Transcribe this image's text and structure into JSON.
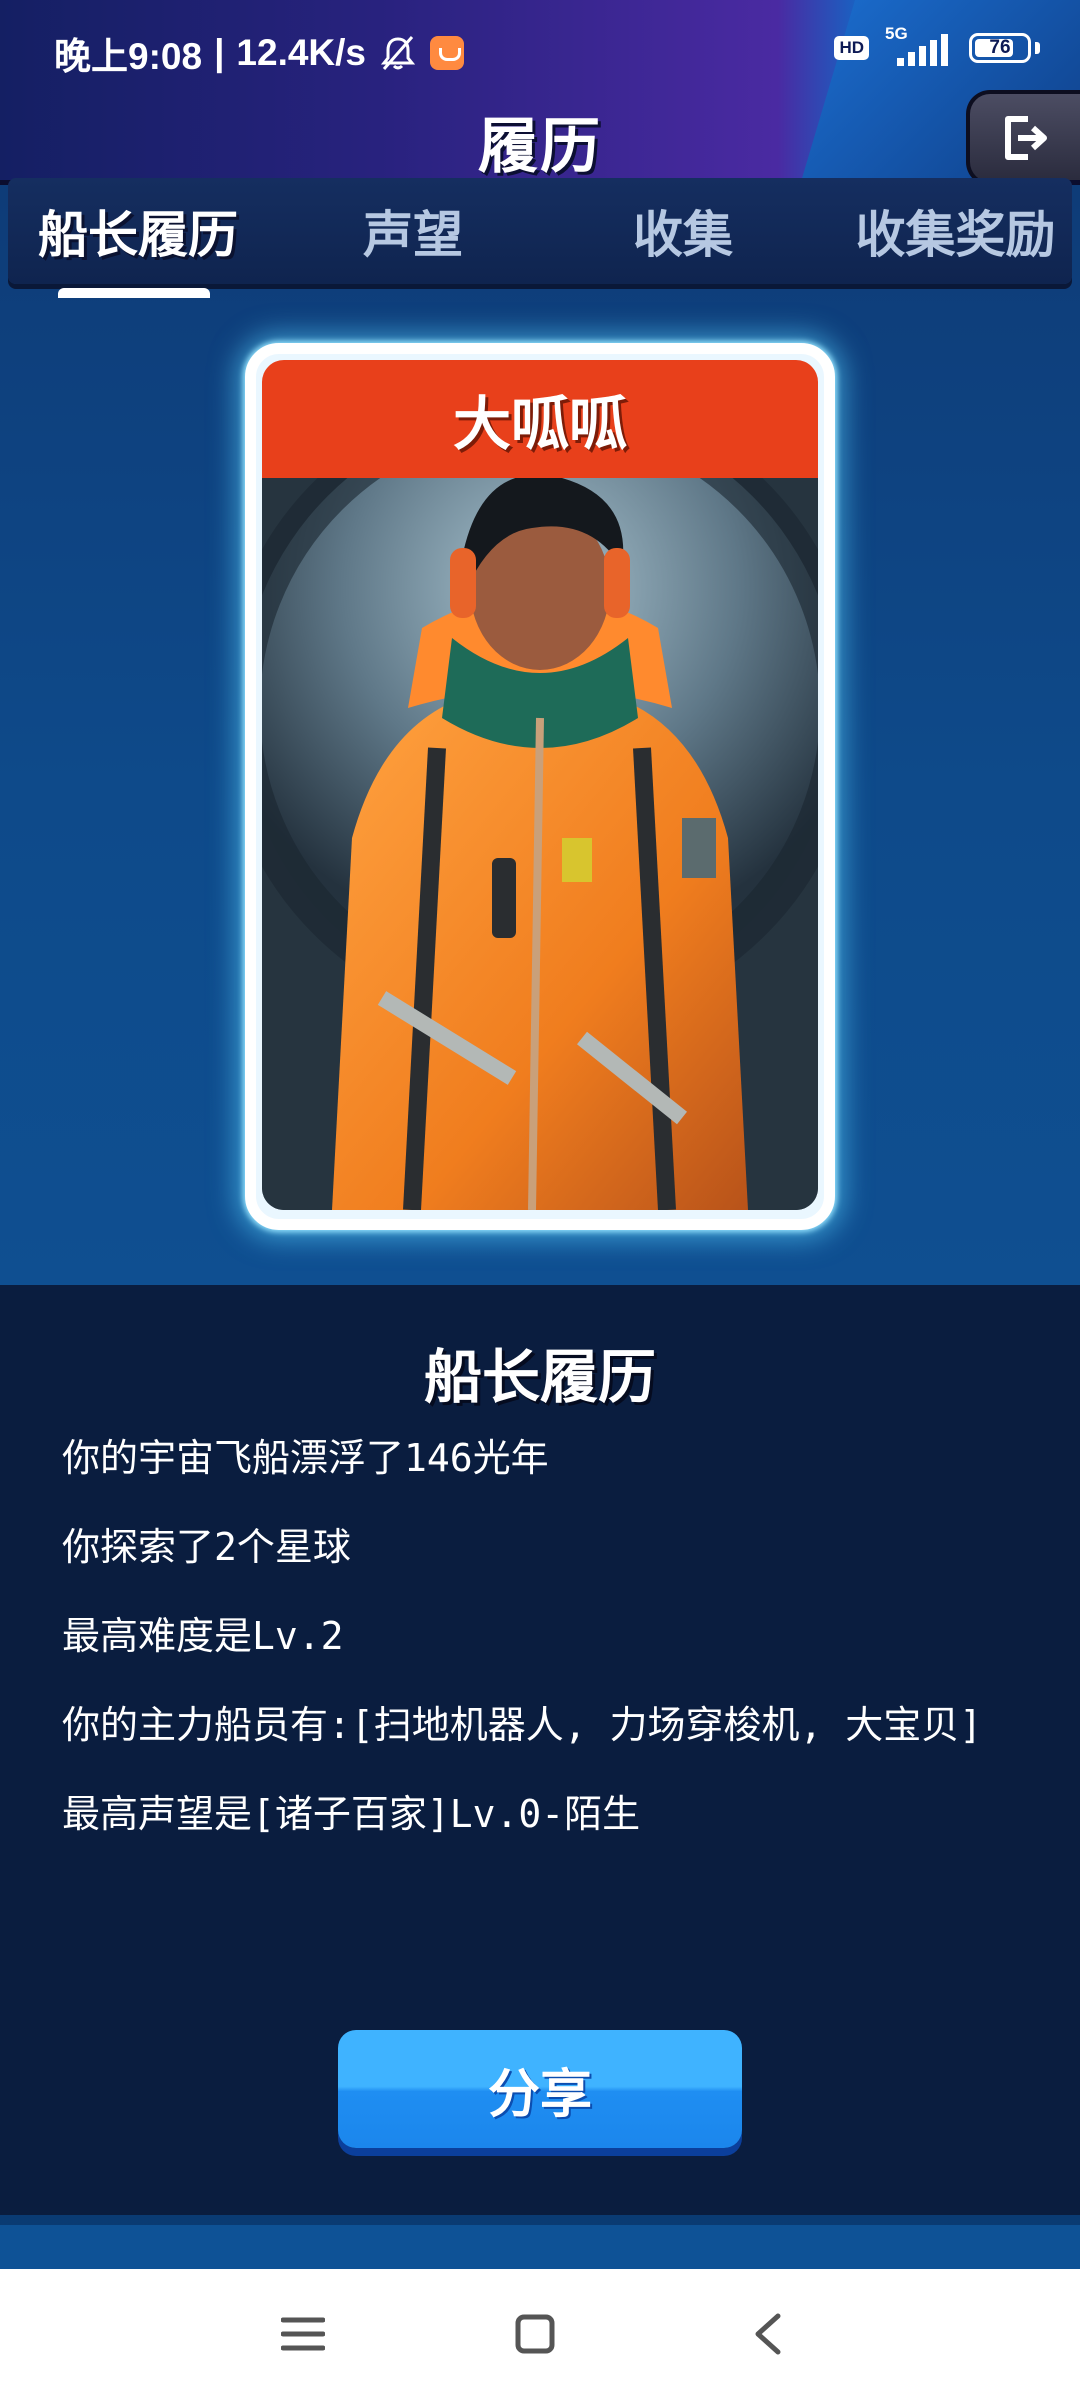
{
  "status_bar": {
    "time": "晚上9:08",
    "net_speed": "12.4K/s",
    "hd_label": "HD",
    "network_label": "5G",
    "battery_level": "76",
    "battery_fraction": 0.76
  },
  "header": {
    "title": "履历"
  },
  "tabs": [
    {
      "label": "船长履历",
      "active": true
    },
    {
      "label": "声望",
      "active": false
    },
    {
      "label": "收集",
      "active": false
    },
    {
      "label": "收集奖励",
      "active": false
    }
  ],
  "card": {
    "name": "大呱呱",
    "name_bar_color": "#e8401b",
    "glow_color": "#5ad2ff"
  },
  "info": {
    "title": "船长履历",
    "lines": [
      "你的宇宙飞船漂浮了146光年",
      "你探索了2个星球",
      "最高难度是Lv.2",
      "你的主力船员有:[扫地机器人, 力场穿梭机, 大宝贝]",
      "最高声望是[诸子百家]Lv.0-陌生"
    ]
  },
  "share_button": {
    "label": "分享",
    "color": "#2a9cf8"
  },
  "icons": {
    "exit": "exit-icon",
    "mute": "mute-icon",
    "nav_menu": "menu-icon",
    "nav_home": "home-icon",
    "nav_back": "back-icon"
  }
}
